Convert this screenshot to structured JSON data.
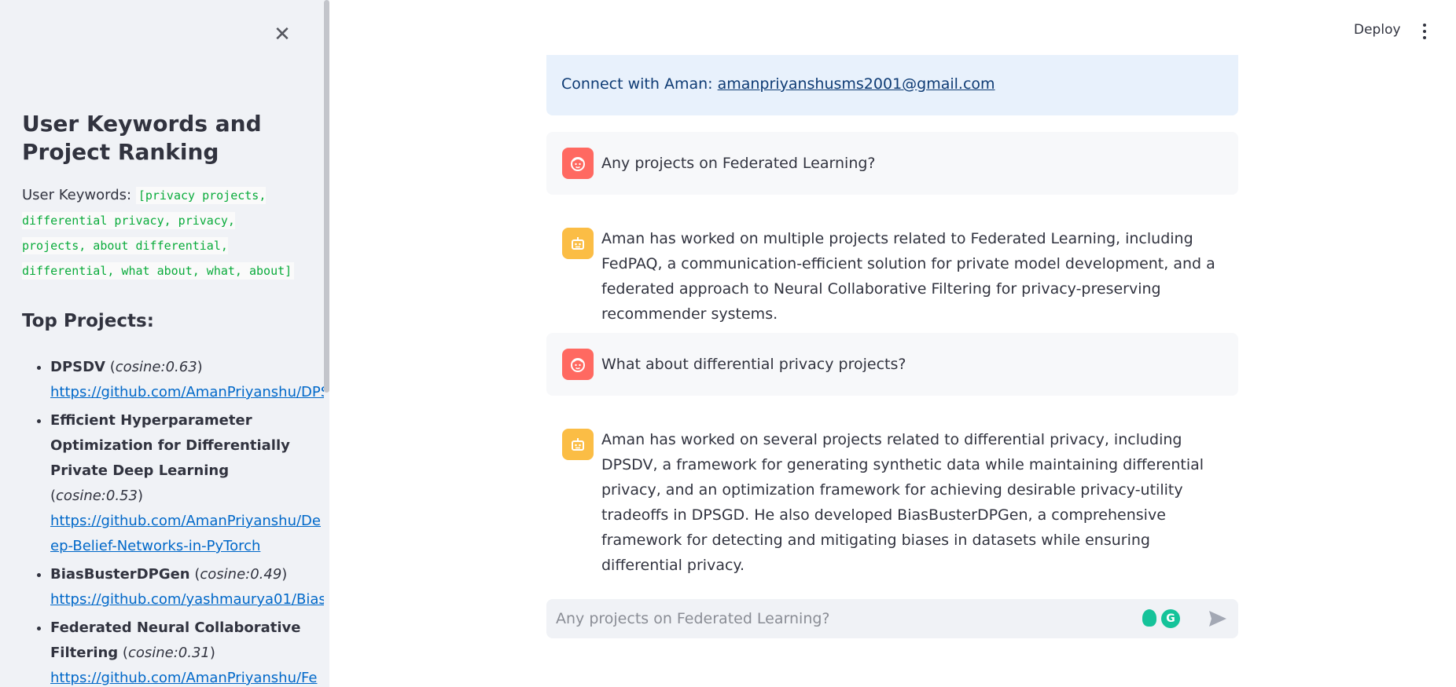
{
  "header": {
    "deploy_label": "Deploy",
    "menu_icon": "kebab-menu-icon"
  },
  "sidebar": {
    "close_icon": "close-icon",
    "title": "User Keywords and Project Ranking",
    "keywords_label": "User Keywords:",
    "keywords_value": "[privacy projects, differential privacy, privacy, projects, about differential, differential, what about, what, about]",
    "top_projects_heading": "Top Projects:",
    "projects": [
      {
        "name": "DPSDV",
        "score": "cosine:0.63",
        "url": "https://github.com/AmanPriyanshu/DPSDV"
      },
      {
        "name": "Efficient Hyperparameter Optimization for Differentially Private Deep Learning",
        "score": "cosine:0.53",
        "url": "https://github.com/AmanPriyanshu/Deep-Belief-Networks-in-PyTorch"
      },
      {
        "name": "BiasBusterDPGen",
        "score": "cosine:0.49",
        "url": "https://github.com/yashmaurya01/BiasBusterDPGen"
      },
      {
        "name": "Federated Neural Collaborative Filtering",
        "score": "cosine:0.31",
        "url": "https://github.com/AmanPriyanshu/Federated-Recommendation-Neural-"
      }
    ]
  },
  "info": {
    "text": "Connect with Aman:",
    "email": "amanpriyanshusms2001@gmail.com"
  },
  "messages": [
    {
      "role": "user",
      "text": "Any projects on Federated Learning?"
    },
    {
      "role": "assistant",
      "text": "Aman has worked on multiple projects related to Federated Learning, including FedPAQ, a communication-efficient solution for private model development, and a federated approach to Neural Collaborative Filtering for privacy-preserving recommender systems."
    },
    {
      "role": "user",
      "text": "What about differential privacy projects?"
    },
    {
      "role": "assistant",
      "text": "Aman has worked on several projects related to differential privacy, including DPSDV, a framework for generating synthetic data while maintaining differential privacy, and an optimization framework for achieving desirable privacy-utility tradeoffs in DPSGD. He also developed BiasBusterDPGen, a comprehensive framework for detecting and mitigating biases in datasets while ensuring differential privacy."
    }
  ],
  "chat_input": {
    "placeholder": "Any projects on Federated Learning?",
    "send_icon": "send-icon"
  },
  "colors": {
    "sidebar_bg": "#f0f2f6",
    "user_avatar": "#ff6961",
    "bot_avatar": "#fbbd45",
    "link": "#0068c9",
    "keyword_code": "#09ab3b",
    "info_bg": "#e8f1fc"
  }
}
